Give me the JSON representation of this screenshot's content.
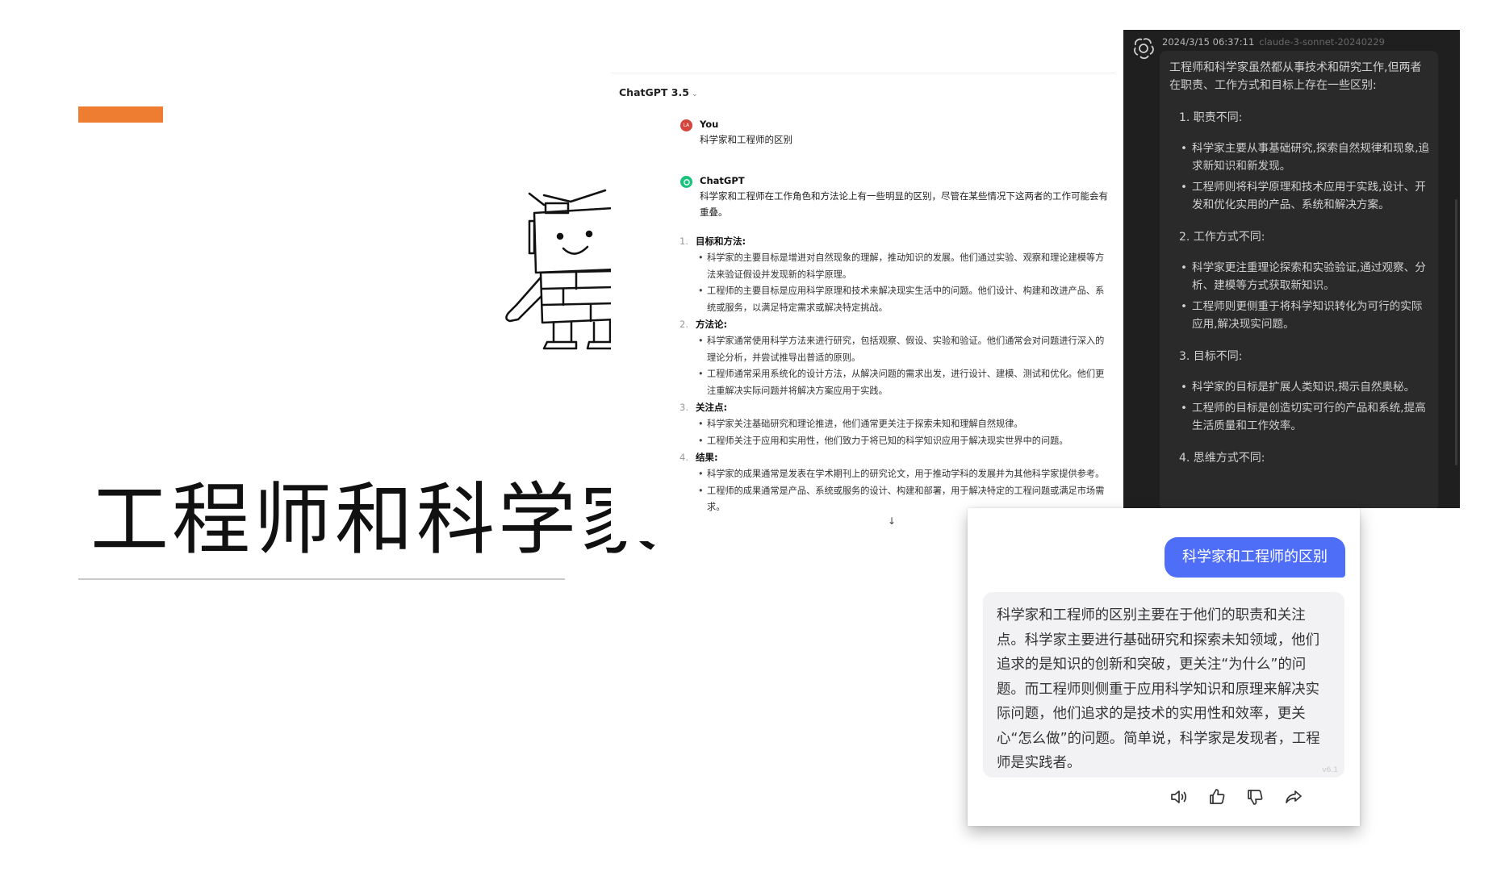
{
  "slide": {
    "title": "工程师和科学家",
    "accent_color": "#ee7d31"
  },
  "chatgpt": {
    "model_label": "ChatGPT 3.5",
    "model_chevron_icon": "chevron-down-icon",
    "user": {
      "name": "You",
      "avatar_text": "LA",
      "avatar_color": "#d6453d",
      "message": "科学家和工程师的区别"
    },
    "assistant": {
      "name": "ChatGPT",
      "avatar_color": "#19c37d",
      "intro": "科学家和工程师在工作角色和方法论上有一些明显的区别，尽管在某些情况下这两者的工作可能会有重叠。",
      "sections": [
        {
          "num": "1.",
          "title": "目标和方法",
          "bullets": [
            "科学家的主要目标是增进对自然现象的理解，推动知识的发展。他们通过实验、观察和理论建模等方法来验证假设并发现新的科学原理。",
            "工程师的主要目标是应用科学原理和技术来解决现实生活中的问题。他们设计、构建和改进产品、系统或服务，以满足特定需求或解决特定挑战。"
          ]
        },
        {
          "num": "2.",
          "title": "方法论",
          "bullets": [
            "科学家通常使用科学方法来进行研究，包括观察、假设、实验和验证。他们通常会对问题进行深入的理论分析，并尝试推导出普适的原则。",
            "工程师通常采用系统化的设计方法，从解决问题的需求出发，进行设计、建模、测试和优化。他们更注重解决实际问题并将解决方案应用于实践。"
          ]
        },
        {
          "num": "3.",
          "title": "关注点",
          "bullets": [
            "科学家关注基础研究和理论推进，他们通常更关注于探索未知和理解自然规律。",
            "工程师关注于应用和实用性，他们致力于将已知的科学知识应用于解决现实世界中的问题。"
          ]
        },
        {
          "num": "4.",
          "title": "结果",
          "bullets": [
            "科学家的成果通常是发表在学术期刊上的研究论文，用于推动学科的发展并为其他科学家提供参考。",
            "工程师的成果通常是产品、系统或服务的设计、构建和部署，用于解决特定的工程问题或满足市场需求。"
          ]
        }
      ]
    },
    "scroll_icon": "arrow-down-icon"
  },
  "claude_panel": {
    "timestamp": "2024/3/15 06:37:11",
    "model": "claude-3-sonnet-20240229",
    "intro": "工程师和科学家虽然都从事技术和研究工作,但两者在职责、工作方式和目标上存在一些区别:",
    "sections": [
      {
        "title": "1. 职责不同:",
        "bullets": [
          "科学家主要从事基础研究,探索自然规律和现象,追求新知识和新发现。",
          "工程师则将科学原理和技术应用于实践,设计、开发和优化实用的产品、系统和解决方案。"
        ]
      },
      {
        "title": "2. 工作方式不同:",
        "bullets": [
          "科学家更注重理论探索和实验验证,通过观察、分析、建模等方式获取新知识。",
          "工程师则更侧重于将科学知识转化为可行的实际应用,解决现实问题。"
        ]
      },
      {
        "title": "3. 目标不同:",
        "bullets": [
          "科学家的目标是扩展人类知识,揭示自然奥秘。",
          "工程师的目标是创造切实可行的产品和系统,提高生活质量和工作效率。"
        ]
      },
      {
        "title": "4. 思维方式不同:",
        "bullets": []
      }
    ]
  },
  "chat_card": {
    "user_message": "科学家和工程师的区别",
    "user_bubble_color": "#4f6ef7",
    "reply": "科学家和工程师的区别主要在于他们的职责和关注点。科学家主要进行基础研究和探索未知领域，他们追求的是知识的创新和突破，更关注“为什么”的问题。而工程师则侧重于应用科学知识和原理来解决实际问题，他们追求的是技术的实用性和效率，更关心“怎么做”的问题。简单说，科学家是发现者，工程师是实践者。",
    "reply_version": "v6.1",
    "actions": [
      "speaker-icon",
      "thumbs-up-icon",
      "thumbs-down-icon",
      "share-icon"
    ]
  }
}
